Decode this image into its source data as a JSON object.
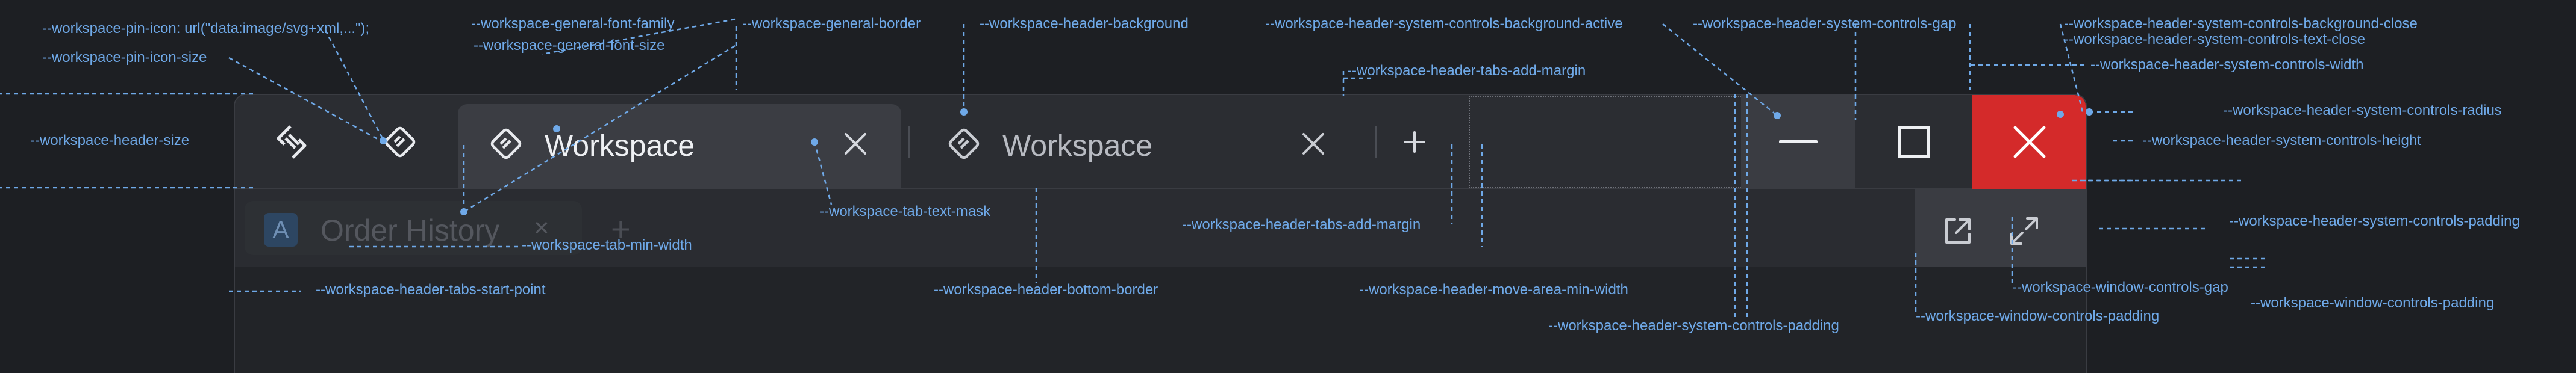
{
  "window": {
    "tabs": [
      {
        "label": "Workspace",
        "icon": "workspace-diamond-icon",
        "active": true,
        "close_icon": "close-icon"
      },
      {
        "label": "Workspace",
        "icon": "workspace-diamond-icon",
        "active": false,
        "close_icon": "close-icon"
      }
    ],
    "add_tab_icon": "plus-icon",
    "app_icon": "app-logo-icon",
    "pin_icon": "workspace-diamond-icon",
    "system_controls": [
      "minimize-icon",
      "maximize-icon",
      "close-icon"
    ],
    "window_controls": [
      "open-external-icon",
      "expand-icon"
    ],
    "ghost_tab": {
      "avatar": "A",
      "label": "Order History",
      "close": "×",
      "add": "+"
    }
  },
  "colors": {
    "background": "#1d1f23",
    "header": "#2b2d32",
    "active_tab": "#3b3d43",
    "close_active": "#d42a2a",
    "annotation": "#6fa9e8"
  },
  "annotations": [
    "--workspace-pin-icon: url(\"data:image/svg+xml,...\");",
    "--workspace-pin-icon-size",
    "--workspace-header-size",
    "--workspace-general-font-family",
    "--workspace-general-font-size",
    "--workspace-general-border",
    "--workspace-header-background",
    "--workspace-header-system-controls-background-active",
    "--workspace-header-system-controls-gap",
    "--workspace-header-system-controls-background-close",
    "--workspace-header-system-controls-text-close",
    "--workspace-header-system-controls-width",
    "--workspace-header-system-controls-radius",
    "--workspace-header-system-controls-height",
    "--workspace-header-system-controls-padding",
    "--workspace-header-tabs-add-margin",
    "--workspace-tab-text-mask",
    "--workspace-tab-min-width",
    "--workspace-header-tabs-start-point",
    "--workspace-header-bottom-border",
    "--workspace-header-tabs-add-margin",
    "--workspace-header-move-area-min-width",
    "--workspace-header-system-controls-padding",
    "--workspace-window-controls-gap",
    "--workspace-window-controls-padding",
    "--workspace-window-controls-padding"
  ]
}
